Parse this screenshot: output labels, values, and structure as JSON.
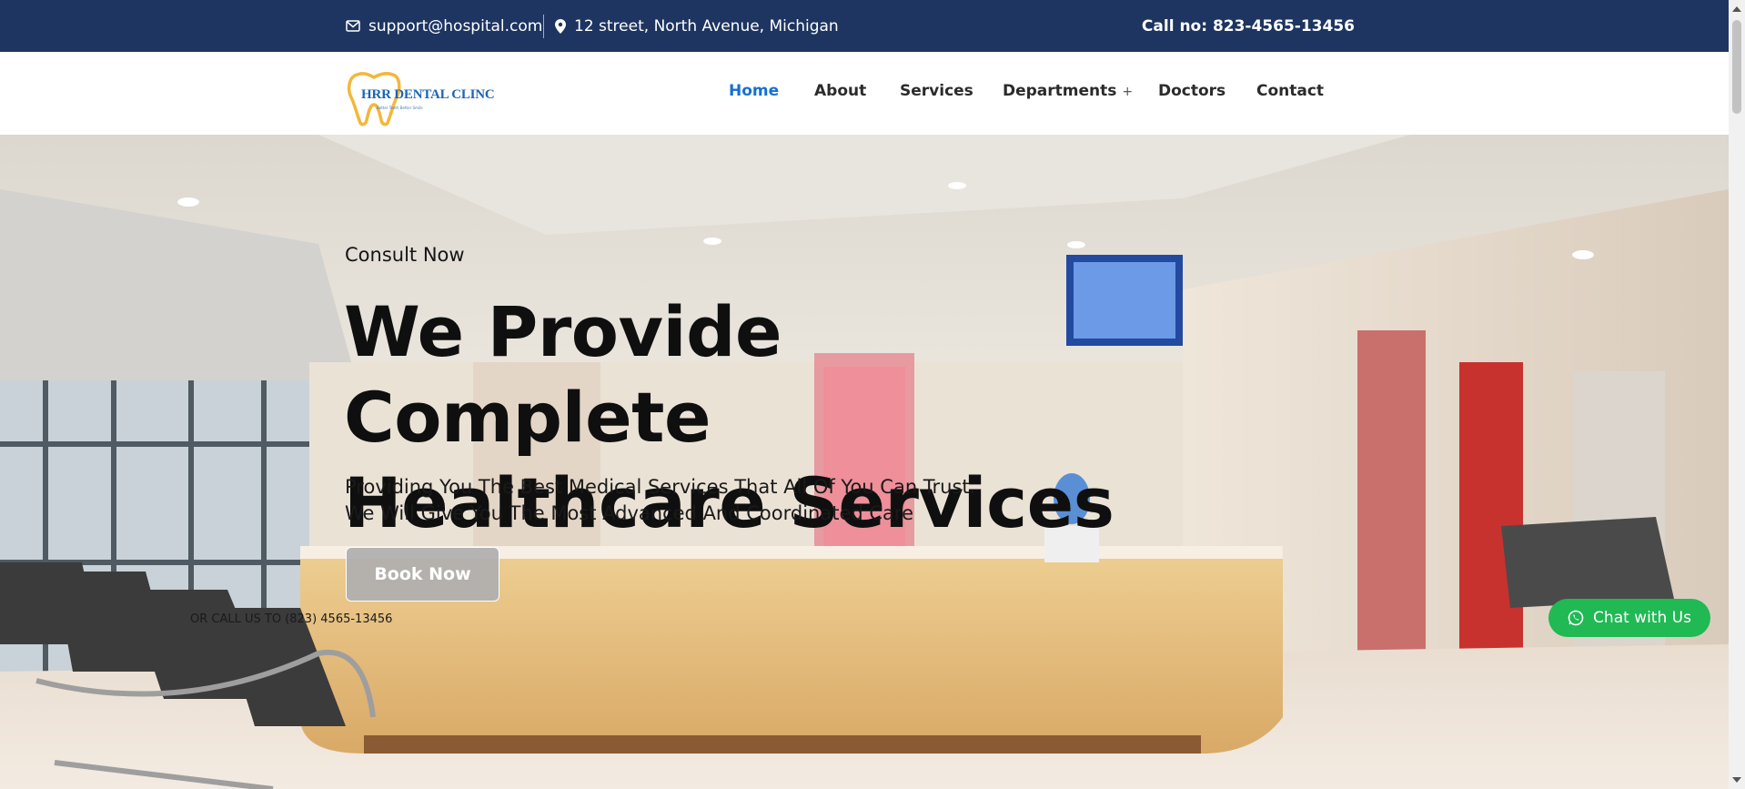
{
  "topbar": {
    "email": "support@hospital.com",
    "address": "12 street, North Avenue, Michigan",
    "call": "Call no: 823-4565-13456"
  },
  "header": {
    "logo_text": "HRR DENTAL CLINC",
    "logo_tagline": "Better Teeth Better Smile",
    "nav": [
      {
        "label": "Home"
      },
      {
        "label": "About"
      },
      {
        "label": "Services"
      },
      {
        "label": "Departments",
        "suffix": "+"
      },
      {
        "label": "Doctors"
      },
      {
        "label": "Contact"
      }
    ]
  },
  "hero": {
    "eyebrow": "Consult Now",
    "title_line1": "We Provide Complete",
    "title_line2": "Healthcare Services",
    "desc_line1": "Providing You The Best Medical Services That All Of You Can Trust.",
    "desc_line2": "We Will Give You The Most Advanced And Coordinated Care",
    "button_label": "Book Now",
    "call_text": "OR CALL US TO (823) 4565-13456"
  },
  "chat": {
    "label": "Chat with Us"
  },
  "colors": {
    "topbar_bg": "#1e3561",
    "nav_active": "#1570d1",
    "chat_bg": "#20b954"
  },
  "icons": [
    "envelope-icon",
    "map-pin-icon",
    "whatsapp-icon",
    "tooth-logo-icon"
  ]
}
